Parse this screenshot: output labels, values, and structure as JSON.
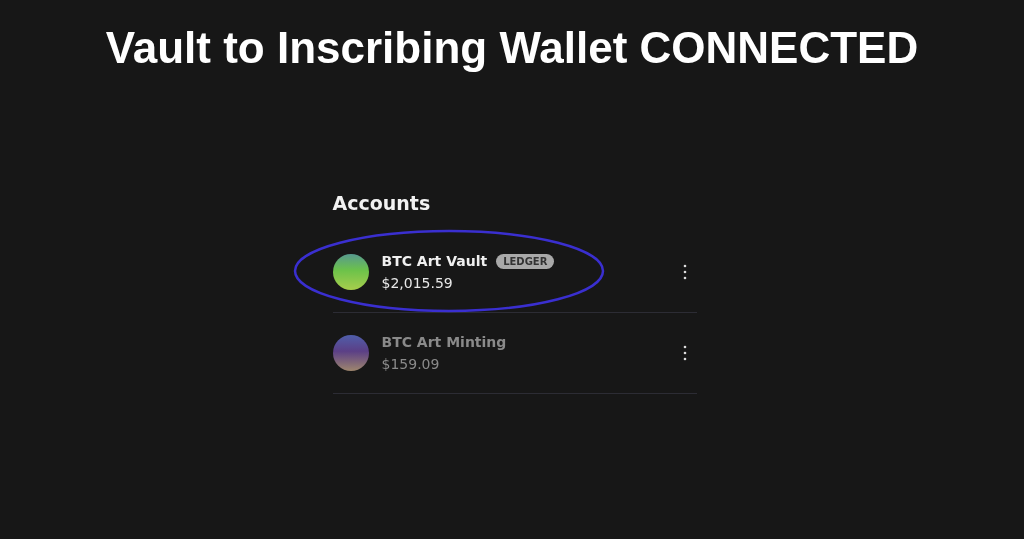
{
  "heading": "Vault to Inscribing Wallet CONNECTED",
  "panel": {
    "title": "Accounts",
    "accounts": [
      {
        "name": "BTC Art Vault",
        "badge": "LEDGER",
        "balance": "$2,015.59",
        "selected": true,
        "circled": true,
        "color": "#6cc24a"
      },
      {
        "name": "BTC Art Minting",
        "balance": "$159.09",
        "selected": false,
        "circled": false,
        "color": "#5b3f86"
      }
    ]
  }
}
